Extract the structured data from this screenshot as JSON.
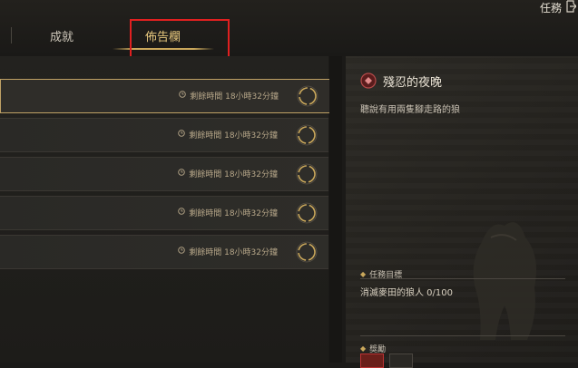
{
  "header": {
    "tabs": [
      {
        "label": "成就"
      },
      {
        "label": "佈告欄"
      }
    ],
    "task_link": "任務"
  },
  "list": {
    "rows": [
      {
        "timer": "剩餘時間 18小時32分鐘"
      },
      {
        "timer": "剩餘時間 18小時32分鐘"
      },
      {
        "timer": "剩餘時間 18小時32分鐘"
      },
      {
        "timer": "剩餘時間 18小時32分鐘"
      },
      {
        "timer": "剩餘時間 18小時32分鐘"
      }
    ]
  },
  "detail": {
    "title": "殘忍的夜晚",
    "description": "聽說有用兩隻腳走路的狼",
    "objective_header": "任務目標",
    "objective": "消滅麥田的狼人 0/100",
    "reward_header": "獎勵"
  },
  "colors": {
    "accent": "#c9a75b",
    "highlight": "#e02020"
  }
}
